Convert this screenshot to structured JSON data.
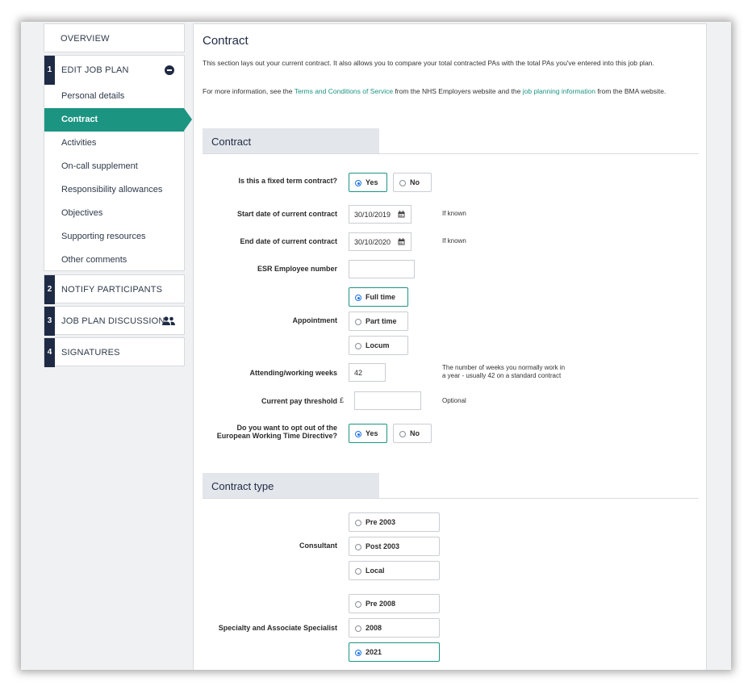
{
  "sidebar": {
    "overview": "OVERVIEW",
    "steps": [
      {
        "num": "1",
        "label": "EDIT JOB PLAN"
      },
      {
        "num": "2",
        "label": "NOTIFY PARTICIPANTS"
      },
      {
        "num": "3",
        "label": "JOB PLAN DISCUSSION"
      },
      {
        "num": "4",
        "label": "SIGNATURES"
      }
    ],
    "items": [
      "Personal details",
      "Contract",
      "Activities",
      "On-call supplement",
      "Responsibility allowances",
      "Objectives",
      "Supporting resources",
      "Other comments"
    ],
    "active_item": "Contract",
    "icons": {
      "step1": "minus-circle-icon",
      "step3": "people-icon"
    }
  },
  "main": {
    "title": "Contract",
    "intro1": "This section lays out your current contract. It also allows you to compare your total contracted PAs with the total PAs you've entered into this job plan.",
    "intro2_pre": "For more information, see the ",
    "intro2_link1": "Terms and Conditions of Service",
    "intro2_mid": " from the NHS Employers website and the ",
    "intro2_link2": "job planning information",
    "intro2_post": " from the BMA website.",
    "section1": "Contract",
    "section2": "Contract type",
    "fixed_term": {
      "label": "Is this a fixed term contract?",
      "yes": "Yes",
      "no": "No",
      "selected": "Yes"
    },
    "start_date": {
      "label": "Start date of current contract",
      "value": "30/10/2019",
      "hint": "If known"
    },
    "end_date": {
      "label": "End date of current contract",
      "value": "30/10/2020",
      "hint": "If known"
    },
    "esr": {
      "label": "ESR Employee number",
      "value": ""
    },
    "appointment": {
      "label": "Appointment",
      "options": [
        "Full time",
        "Part time",
        "Locum"
      ],
      "selected": "Full time"
    },
    "weeks": {
      "label": "Attending/working weeks",
      "value": "42",
      "hint1": "The number of weeks you normally work in",
      "hint2": "a year - usually 42 on a standard contract"
    },
    "pay": {
      "label": "Current pay threshold",
      "currency": "£",
      "value": "",
      "hint": "Optional"
    },
    "wtd": {
      "label1": "Do you want to opt out of the",
      "label2": "European Working Time Directive?",
      "yes": "Yes",
      "no": "No",
      "selected": "Yes"
    },
    "consultant": {
      "label": "Consultant",
      "options": [
        "Pre 2003",
        "Post 2003",
        "Local"
      ]
    },
    "sas": {
      "label": "Specialty and Associate Specialist",
      "options": [
        "Pre 2008",
        "2008",
        "2021"
      ],
      "selected": "2021"
    }
  },
  "colors": {
    "accent": "#1c9482",
    "navy": "#1f2a44",
    "radio": "#1a73e8"
  }
}
